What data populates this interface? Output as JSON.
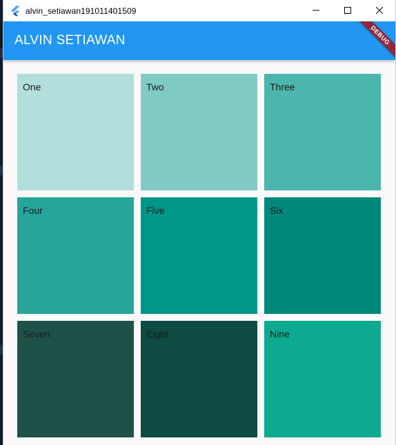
{
  "window": {
    "title": "alvin_setiawan191011401509"
  },
  "appbar": {
    "title": "ALVIN SETIAWAN",
    "color": "#2196f3"
  },
  "debug_banner": {
    "label": "DEBUG"
  },
  "grid": {
    "tiles": [
      {
        "label": "One",
        "color": "#b2dfdb"
      },
      {
        "label": "Two",
        "color": "#80cbc4"
      },
      {
        "label": "Three",
        "color": "#4db6ac"
      },
      {
        "label": "Four",
        "color": "#26a69a"
      },
      {
        "label": "Five",
        "color": "#009688"
      },
      {
        "label": "Six",
        "color": "#00897b"
      },
      {
        "label": "Seven",
        "color": "#1e5249"
      },
      {
        "label": "Eight",
        "color": "#0e4b42"
      },
      {
        "label": "Nine",
        "color": "#0daa8f"
      }
    ]
  },
  "icons": {
    "app": "flutter-icon",
    "minimize": "minimize-icon",
    "maximize": "maximize-icon",
    "close": "close-icon"
  }
}
